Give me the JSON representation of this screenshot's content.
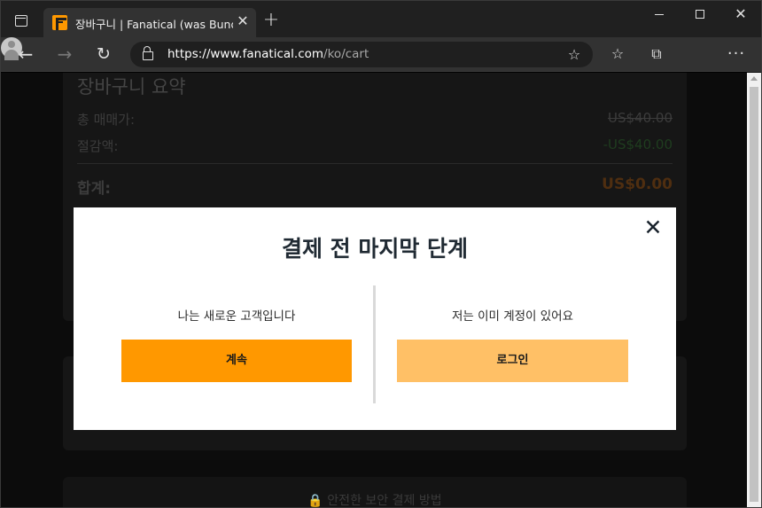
{
  "browser": {
    "tab_title": "장바구니 | Fanatical (was Bundle",
    "tab_close": "✕",
    "new_tab": "+",
    "url_main": "https://www.fanatical.com",
    "url_path": "/ko/cart",
    "minimize": "",
    "close": "✕"
  },
  "cart_summary": {
    "title": "장바구니 요약",
    "subtotal_label": "총 매매가:",
    "subtotal_value": "US$40.00",
    "discount_label": "절감액:",
    "discount_value": "-US$40.00",
    "total_label": "합계:",
    "total_value": "US$0.00"
  },
  "footer": {
    "secure_payment": "🔒 안전한 보안 결제 방법"
  },
  "modal": {
    "title": "결제 전 마지막 단계",
    "close": "✕",
    "new_customer_label": "나는 새로운 고객입니다",
    "continue_button": "계속",
    "existing_account_label": "저는 이미 계정이 있어요",
    "login_button": "로그인"
  },
  "colors": {
    "brand_orange": "#ff9800",
    "login_orange": "#ffc066"
  }
}
